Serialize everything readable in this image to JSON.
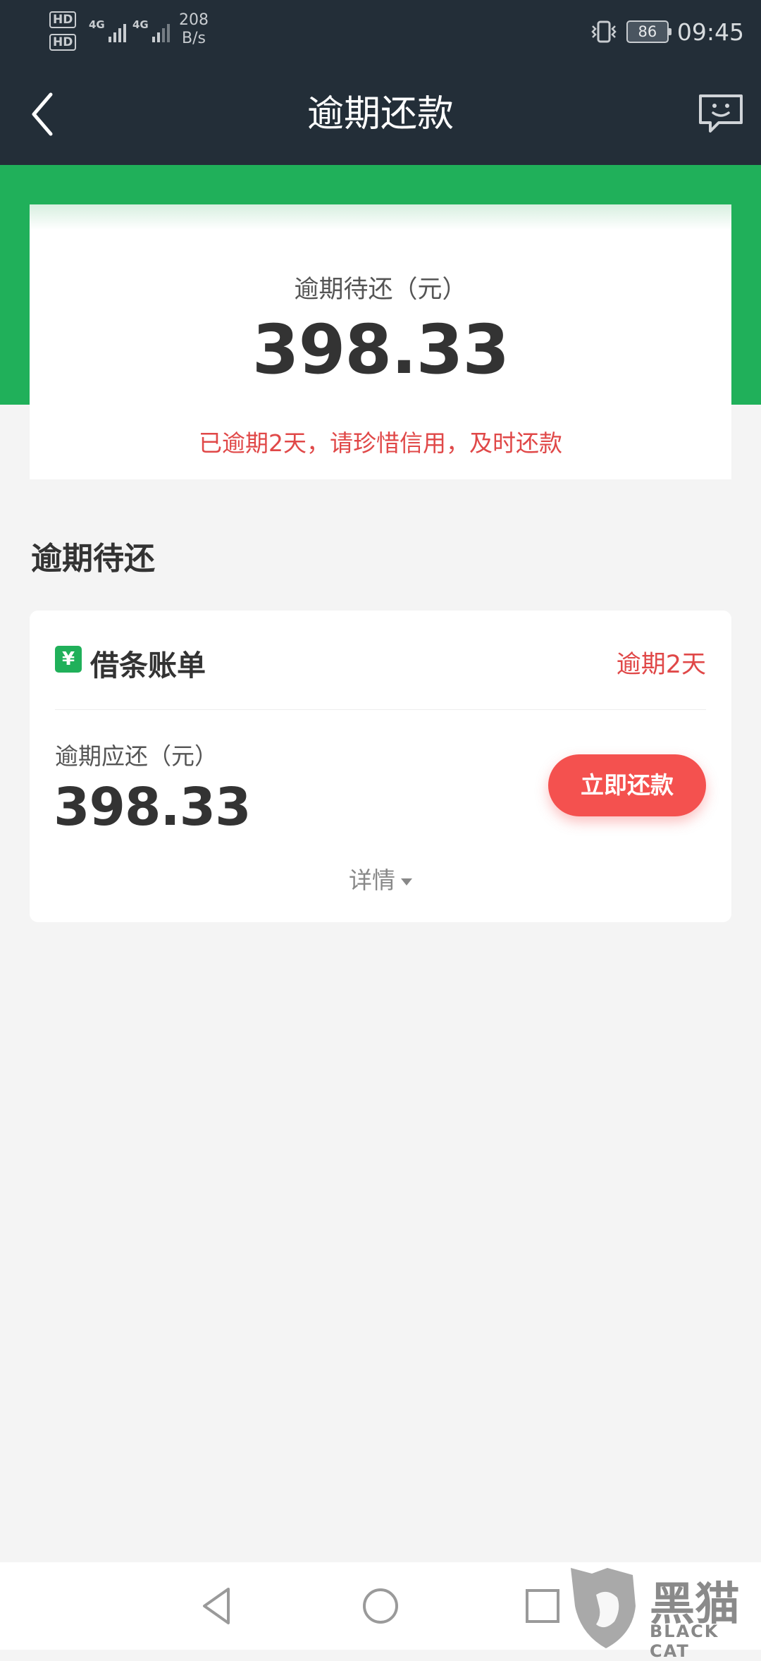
{
  "status_bar": {
    "sim1": "HD",
    "sim2": "HD",
    "net1": "4G",
    "net2": "4G",
    "speed_value": "208",
    "speed_unit": "B/s",
    "battery": "86",
    "time": "09:45"
  },
  "header": {
    "title": "逾期还款"
  },
  "summary": {
    "label": "逾期待还（元）",
    "amount": "398.33",
    "warning": "已逾期2天，请珍惜信用，及时还款"
  },
  "section": {
    "title": "逾期待还"
  },
  "bill": {
    "icon_symbol": "¥",
    "name": "借条账单",
    "overdue": "逾期2天",
    "due_label": "逾期应还（元）",
    "due_amount": "398.33",
    "pay_button": "立即还款",
    "details": "详情"
  },
  "watermark": {
    "cn": "黑猫",
    "en": "BLACK CAT"
  },
  "colors": {
    "accent_green": "#20b05a",
    "warning_red": "#e04848",
    "button_red": "#f4514f",
    "header_dark": "#232e38"
  }
}
